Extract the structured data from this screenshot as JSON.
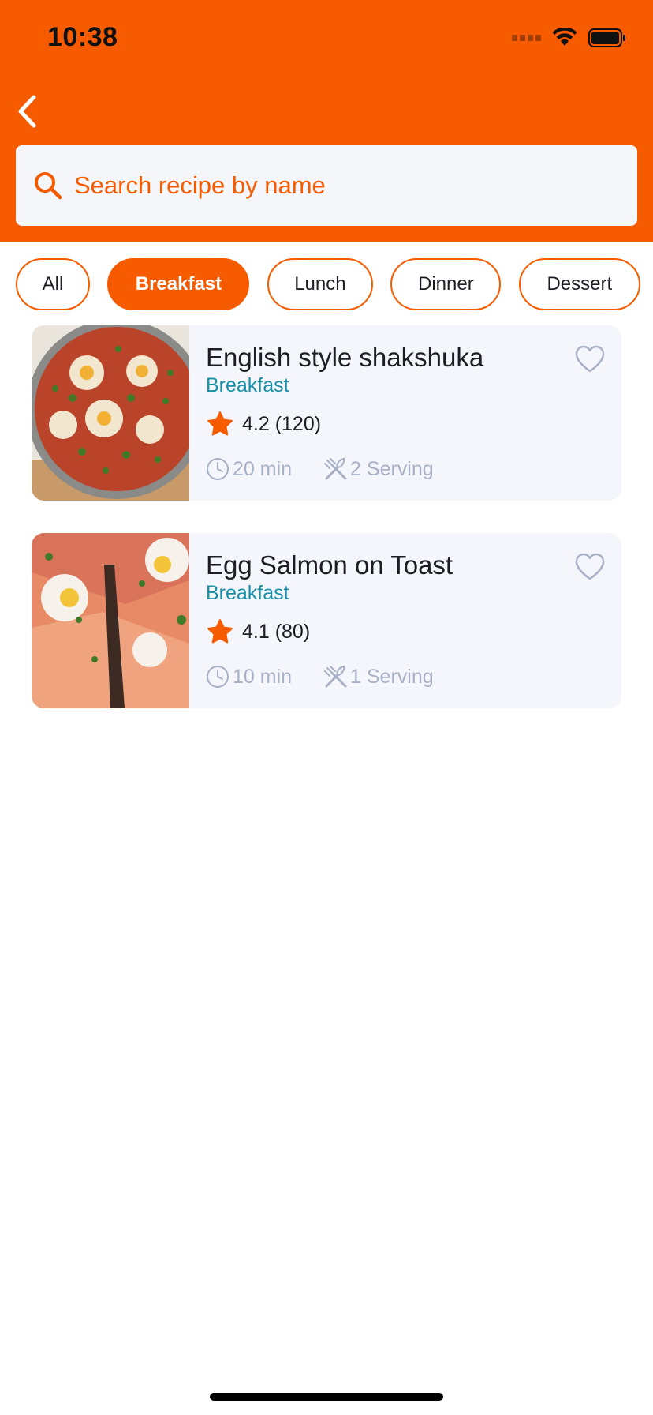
{
  "status_bar": {
    "time": "10:38"
  },
  "search": {
    "placeholder": "Search recipe by name"
  },
  "categories": [
    {
      "label": "All",
      "active": false
    },
    {
      "label": "Breakfast",
      "active": true
    },
    {
      "label": "Lunch",
      "active": false
    },
    {
      "label": "Dinner",
      "active": false
    },
    {
      "label": "Dessert",
      "active": false
    }
  ],
  "recipes": [
    {
      "title": "English style shakshuka",
      "category": "Breakfast",
      "rating": "4.2 (120)",
      "time": "20 min",
      "serving": "2 Serving"
    },
    {
      "title": "Egg Salmon on Toast",
      "category": "Breakfast",
      "rating": "4.1 (80)",
      "time": "10 min",
      "serving": "1 Serving"
    }
  ],
  "colors": {
    "accent": "#f75b00",
    "category": "#1790a8",
    "muted": "#a8b0c6",
    "card": "#f4f6fb"
  },
  "icons": [
    "back-icon",
    "search-icon",
    "star-icon",
    "clock-icon",
    "utensils-icon",
    "heart-icon"
  ]
}
